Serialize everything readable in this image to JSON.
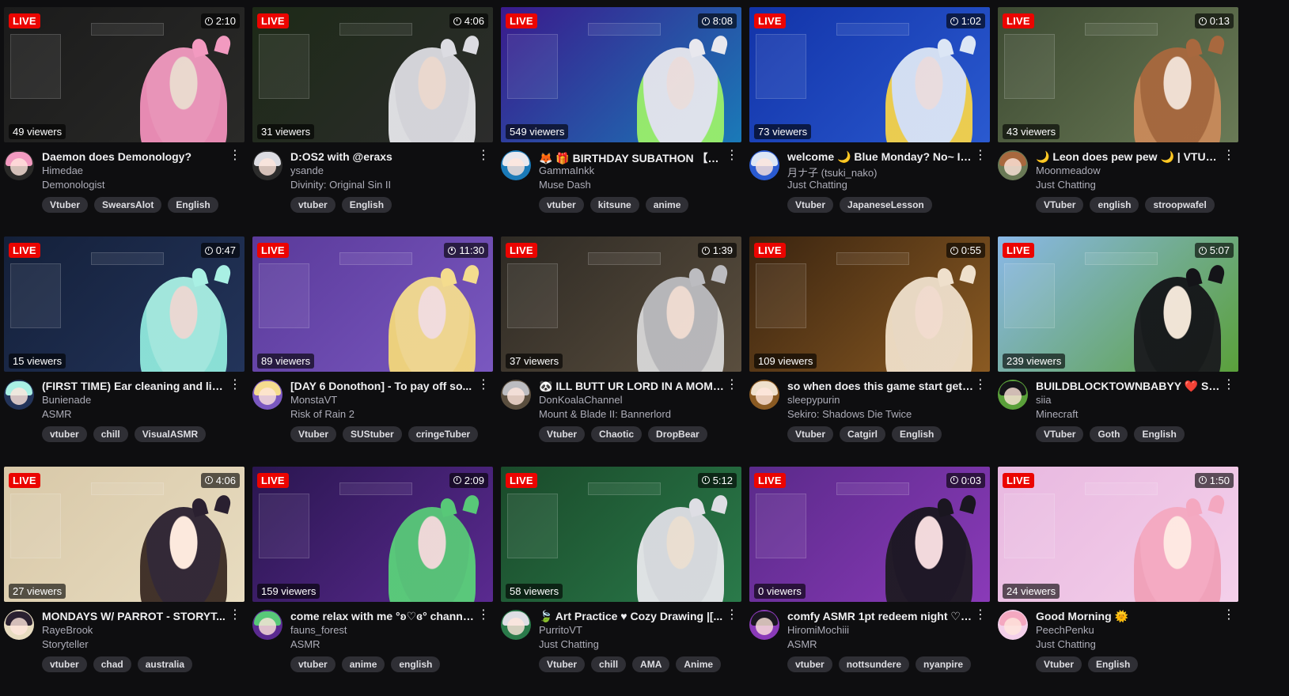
{
  "labels": {
    "live": "LIVE"
  },
  "streams": [
    {
      "uptime": "2:10",
      "viewers": "49 viewers",
      "title": "Daemon does Demonology?",
      "channel": "Himedae",
      "category": "Demonologist",
      "tags": [
        "Vtuber",
        "SwearsAlot",
        "English"
      ],
      "colors": {
        "bg1": "#1b1b1b",
        "bg2": "#2a2a28",
        "accent": "#f08fb9",
        "hair": "#f29ac0"
      }
    },
    {
      "uptime": "4:06",
      "viewers": "31 viewers",
      "title": "D:OS2 with @eraxs",
      "channel": "ysande",
      "category": "Divinity: Original Sin II",
      "tags": [
        "vtuber",
        "English"
      ],
      "colors": {
        "bg1": "#1d2a17",
        "bg2": "#2c2c2c",
        "accent": "#e6e6ea",
        "hair": "#dcdce2"
      }
    },
    {
      "uptime": "8:08",
      "viewers": "549 viewers",
      "title": "🦊 🎁 BIRTHDAY SUBATHON 【D...",
      "channel": "GammaInkk",
      "category": "Muse Dash",
      "tags": [
        "vtuber",
        "kitsune",
        "anime"
      ],
      "colors": {
        "bg1": "#3a1a8c",
        "bg2": "#1a7ab8",
        "accent": "#9bf06a",
        "hair": "#e8e8ee"
      }
    },
    {
      "uptime": "1:02",
      "viewers": "73 viewers",
      "title": "welcome 🌙 Blue Monday? No~ It'...",
      "channel": "月ナ子 (tsuki_nako)",
      "category": "Just Chatting",
      "tags": [
        "Vtuber",
        "JapaneseLesson"
      ],
      "colors": {
        "bg1": "#1233a8",
        "bg2": "#2a5ad0",
        "accent": "#f5d24a",
        "hair": "#dce6f5"
      }
    },
    {
      "uptime": "0:13",
      "viewers": "43 viewers",
      "title": "🌙 Leon does pew pew 🌙 | VTUB...",
      "channel": "Moonmeadow",
      "category": "Just Chatting",
      "tags": [
        "VTuber",
        "english",
        "stroopwafel"
      ],
      "colors": {
        "bg1": "#3d4a32",
        "bg2": "#6a7a56",
        "accent": "#c98a5a",
        "hair": "#a8683e"
      }
    },
    {
      "uptime": "0:47",
      "viewers": "15 viewers",
      "title": "(FIRST TIME) Ear cleaning and lick...",
      "channel": "Bunienade",
      "category": "ASMR",
      "tags": [
        "vtuber",
        "chill",
        "VisualASMR"
      ],
      "colors": {
        "bg1": "#14203a",
        "bg2": "#23345a",
        "accent": "#8fe8dc",
        "hair": "#a9f0e4"
      }
    },
    {
      "uptime": "11:30",
      "viewers": "89 viewers",
      "title": "[DAY 6 Donothon] - To pay off so...",
      "channel": "MonstaVT",
      "category": "Risk of Rain 2",
      "tags": [
        "Vtuber",
        "SUStuber",
        "cringeTuber"
      ],
      "colors": {
        "bg1": "#5a3a9a",
        "bg2": "#7a58c0",
        "accent": "#f3d77a",
        "hair": "#f4dc8e"
      }
    },
    {
      "uptime": "1:39",
      "viewers": "37 viewers",
      "title": "🐼 ILL BUTT UR LORD IN A MOME...",
      "channel": "DonKoalaChannel",
      "category": "Mount & Blade II: Bannerlord",
      "tags": [
        "Vtuber",
        "Chaotic",
        "DropBear"
      ],
      "colors": {
        "bg1": "#2e2a24",
        "bg2": "#5a4e3e",
        "accent": "#d8d8d8",
        "hair": "#bcbcc0"
      }
    },
    {
      "uptime": "0:55",
      "viewers": "109 viewers",
      "title": "so when does this game start gett...",
      "channel": "sleepypurin",
      "category": "Sekiro: Shadows Die Twice",
      "tags": [
        "Vtuber",
        "Catgirl",
        "English"
      ],
      "colors": {
        "bg1": "#3a2410",
        "bg2": "#8a5a22",
        "accent": "#f0e0c8",
        "hair": "#efe0cc"
      }
    },
    {
      "uptime": "5:07",
      "viewers": "239 viewers",
      "title": "BUILDBLOCKTOWNBABYY ❤️ Sia...",
      "channel": "siia",
      "category": "Minecraft",
      "tags": [
        "VTuber",
        "Goth",
        "English"
      ],
      "colors": {
        "bg1": "#8ab8e8",
        "bg2": "#5aa03a",
        "accent": "#1a1a1e",
        "hair": "#141418"
      }
    },
    {
      "uptime": "4:06",
      "viewers": "27 viewers",
      "title": "MONDAYS W/ PARROT - STORYT...",
      "channel": "RayeBrook",
      "category": "Storyteller",
      "tags": [
        "vtuber",
        "chad",
        "australia"
      ],
      "colors": {
        "bg1": "#d8c8a8",
        "bg2": "#e8dcc0",
        "accent": "#3a2a22",
        "hair": "#2a2030"
      }
    },
    {
      "uptime": "2:09",
      "viewers": "159 viewers",
      "title": "come relax with me °ʚ♡ɞ° channel...",
      "channel": "fauns_forest",
      "category": "ASMR",
      "tags": [
        "vtuber",
        "anime",
        "english"
      ],
      "colors": {
        "bg1": "#2a1650",
        "bg2": "#5a2a90",
        "accent": "#5ad07a",
        "hair": "#58c878"
      }
    },
    {
      "uptime": "5:12",
      "viewers": "58 viewers",
      "title": "🍃 Art Practice ♥ Cozy Drawing |[...",
      "channel": "PurritoVT",
      "category": "Just Chatting",
      "tags": [
        "Vtuber",
        "chill",
        "AMA",
        "Anime"
      ],
      "colors": {
        "bg1": "#1a4a2a",
        "bg2": "#2a7a4a",
        "accent": "#e8e8ec",
        "hair": "#dedee4"
      }
    },
    {
      "uptime": "0:03",
      "viewers": "0 viewers",
      "title": "comfy ASMR 1pt redeem night ♡ !t...",
      "channel": "HiromiMochiii",
      "category": "ASMR",
      "tags": [
        "vtuber",
        "nottsundere",
        "nyanpire"
      ],
      "colors": {
        "bg1": "#5a2a8a",
        "bg2": "#8a3ab8",
        "accent": "#1e1a22",
        "hair": "#1a1620"
      }
    },
    {
      "uptime": "1:50",
      "viewers": "24 viewers",
      "title": "Good Morning 🌞",
      "channel": "PeechPenku",
      "category": "Just Chatting",
      "tags": [
        "Vtuber",
        "English"
      ],
      "colors": {
        "bg1": "#e8b8e0",
        "bg2": "#f4d0ea",
        "accent": "#f0a0b8",
        "hair": "#f4a8c0"
      }
    }
  ]
}
